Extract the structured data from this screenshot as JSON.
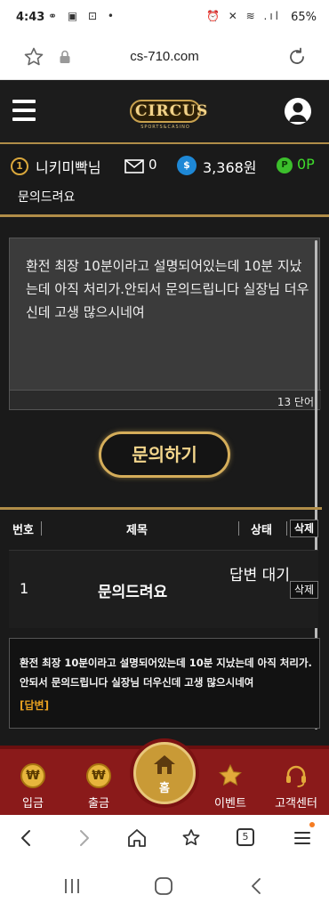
{
  "status_bar": {
    "time": "4:43",
    "left_icons": "⚭ ▣ ⊡ •",
    "right_icons": "⏰ ✕ ≋ .ıl",
    "battery": "65%"
  },
  "browser": {
    "url": "cs-710.com",
    "tab_count": "5"
  },
  "site": {
    "logo_main": "CIRCUS",
    "logo_sub": "SPORTS&CASINO"
  },
  "user": {
    "level": "1",
    "nickname": "니키미빡님",
    "mail_count": "0",
    "money": "3,368원",
    "points": "0P"
  },
  "form": {
    "subject": "문의드려요",
    "message": "환전 최장 10분이라고 설명되어있는데 10분 지났는데 아직 처리가.안되서 문의드립니다 실장님 더우신데 고생 많으시네여",
    "word_count": "13 단어",
    "submit_label": "문의하기"
  },
  "table": {
    "headers": {
      "num": "번호",
      "title": "제목",
      "status": "상태",
      "delete": "삭제"
    },
    "rows": [
      {
        "num": "1",
        "title": "문의드려요",
        "status": "답변 대기",
        "delete": "삭제"
      }
    ],
    "expanded_message": "환전 최장 10분이라고 설명되어있는데 10분 지났는데 아직 처리가.안되서 문의드립니다 실장님 더우신데 고생 많으시네여",
    "answer_tag": "[답변]"
  },
  "bottom_nav": {
    "deposit": "입금",
    "withdraw": "출금",
    "home": "홈",
    "event": "이벤트",
    "support": "고객센터"
  },
  "colors": {
    "gold": "#b08d48",
    "nav_red": "#8a1a1a",
    "points_green": "#3fdc2c",
    "answer_orange": "#e8a020"
  }
}
